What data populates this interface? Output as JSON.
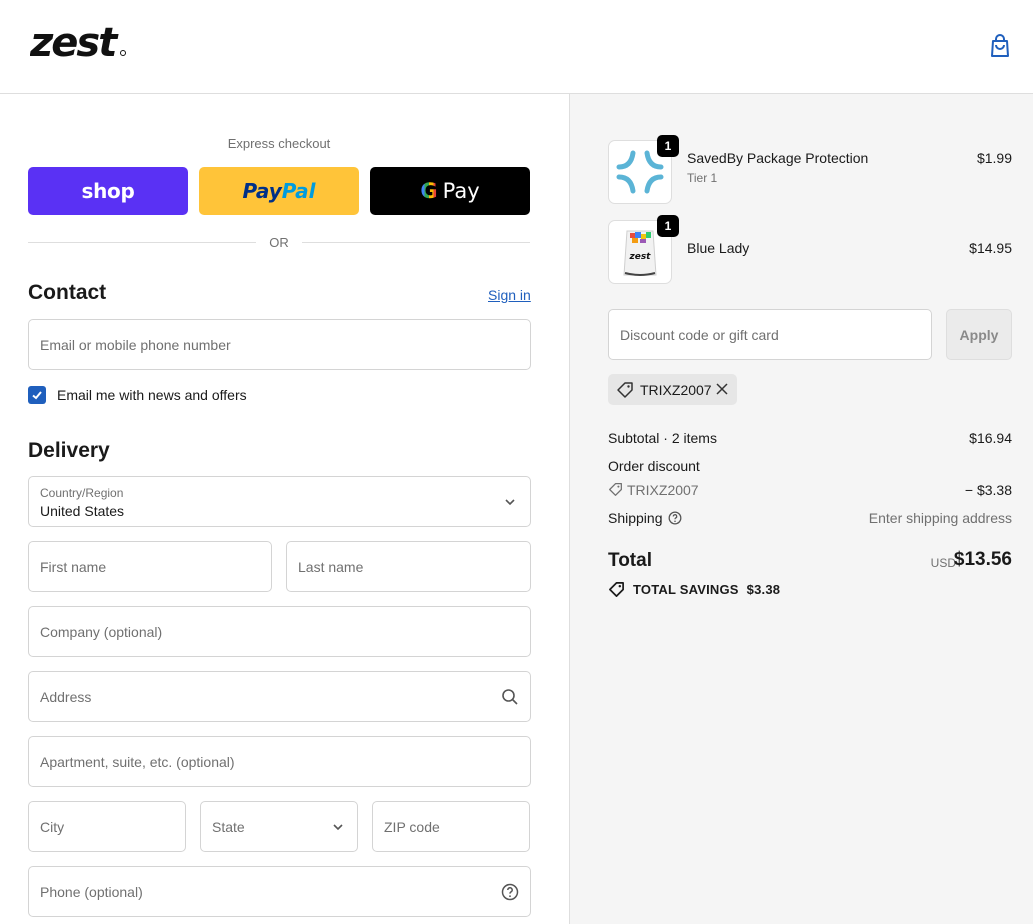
{
  "brand": {
    "logo_text": "zest"
  },
  "express": {
    "title": "Express checkout",
    "shop_label": "shop",
    "paypal_part1": "Pay",
    "paypal_part2": "Pal",
    "gpay_g": "G",
    "gpay_label": "Pay",
    "or_text": "OR"
  },
  "contact": {
    "title": "Contact",
    "sign_in": "Sign in",
    "email_placeholder": "Email or mobile phone number",
    "newsletter_label": "Email me with news and offers",
    "newsletter_checked": true
  },
  "delivery": {
    "title": "Delivery",
    "country_label": "Country/Region",
    "country_value": "United States",
    "first_name": "First name",
    "last_name": "Last name",
    "company": "Company (optional)",
    "address": "Address",
    "apartment": "Apartment, suite, etc. (optional)",
    "city": "City",
    "state": "State",
    "zip": "ZIP code",
    "phone": "Phone (optional)"
  },
  "order": {
    "items": [
      {
        "name": "SavedBy Package Protection",
        "variant": "Tier 1",
        "price": "$1.99",
        "qty": "1"
      },
      {
        "name": "Blue Lady",
        "variant": "",
        "price": "$14.95",
        "qty": "1",
        "package_text": "zest"
      }
    ],
    "discount_placeholder": "Discount code or gift card",
    "apply_label": "Apply",
    "applied_code": "TRIXZ2007",
    "subtotal_label": "Subtotal · 2 items",
    "subtotal_value": "$16.94",
    "order_discount_label": "Order discount",
    "discount_code": "TRIXZ2007",
    "discount_value": "− $3.38",
    "shipping_label": "Shipping",
    "shipping_value": "Enter shipping address",
    "total_label": "Total",
    "currency": "USD",
    "total_value": "$13.56",
    "savings_label": "TOTAL SAVINGS",
    "savings_value": "$3.38"
  },
  "colors": {
    "accent": "#1f5fbd",
    "shop": "#5a31f4",
    "paypal": "#ffc439",
    "gpay": "#000000",
    "summary_bg": "#f5f5f5"
  }
}
